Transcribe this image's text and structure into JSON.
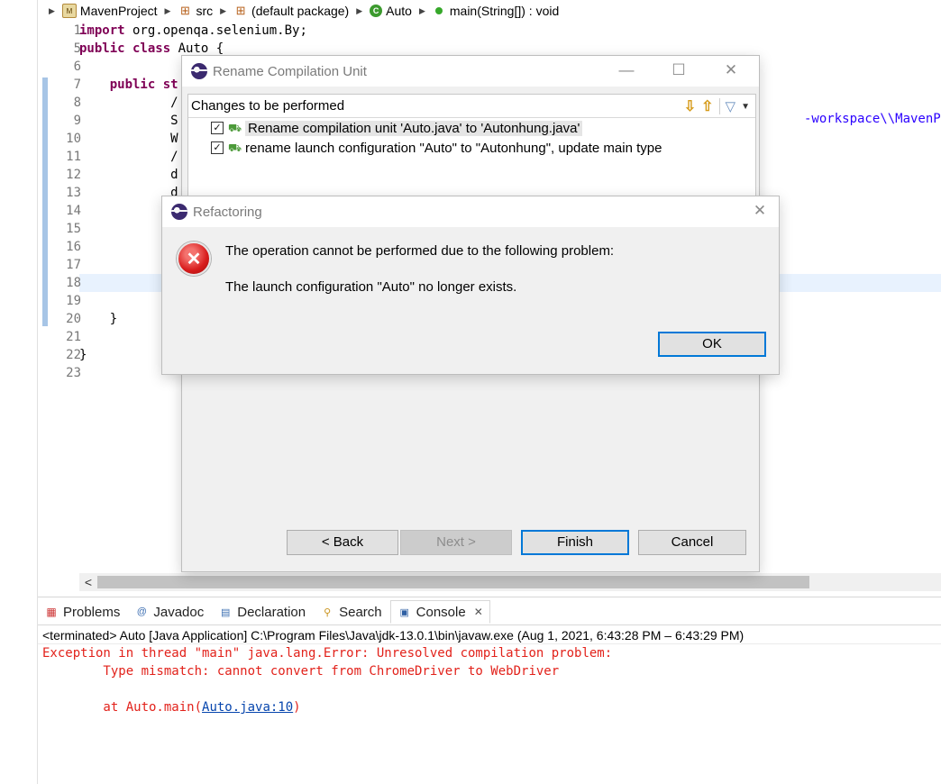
{
  "breadcrumb": {
    "project": "MavenProject",
    "src": "src",
    "package": "(default package)",
    "class": "Auto",
    "method": "main(String[]) : void"
  },
  "editor": {
    "line_numbers": [
      "1",
      "5",
      "6",
      "7",
      "8",
      "9",
      "10",
      "11",
      "12",
      "13",
      "14",
      "15",
      "16",
      "17",
      "18",
      "19",
      "20",
      "21",
      "22",
      "23"
    ],
    "lines": [
      {
        "kw": "import",
        "rest": " org.openqa.selenium.By;"
      },
      {
        "kw": "public class",
        "rest": " Auto {"
      },
      {
        "kw": "",
        "rest": ""
      },
      {
        "kw": "    public st",
        "rest": ""
      },
      {
        "kw": "",
        "rest": "            /"
      },
      {
        "kw": "",
        "rest": "            S"
      },
      {
        "kw": "",
        "rest": "            W"
      },
      {
        "kw": "",
        "rest": "            /"
      },
      {
        "kw": "",
        "rest": "            d"
      },
      {
        "kw": "",
        "rest": "            d"
      },
      {
        "kw": "",
        "rest": ""
      },
      {
        "kw": "",
        "rest": ""
      },
      {
        "kw": "",
        "rest": ""
      },
      {
        "kw": "",
        "rest": ""
      },
      {
        "kw": "",
        "rest": ""
      },
      {
        "kw": "",
        "rest": ""
      },
      {
        "kw": "",
        "rest": "    }"
      },
      {
        "kw": "",
        "rest": ""
      },
      {
        "kw": "",
        "rest": "}"
      },
      {
        "kw": "",
        "rest": ""
      }
    ],
    "string_fragment": "-workspace\\\\MavenProjec"
  },
  "rename_dialog": {
    "title": "Rename Compilation Unit",
    "changes_label": "Changes to be performed",
    "changes": [
      {
        "text": "Rename compilation unit 'Auto.java' to 'Autonhung.java'",
        "checked": true
      },
      {
        "text": "rename launch configuration \"Auto\" to \"Autonhung\", update main type",
        "checked": true
      }
    ],
    "back_label": "< Back",
    "next_label": "Next >",
    "finish_label": "Finish",
    "cancel_label": "Cancel"
  },
  "refactoring_dialog": {
    "title": "Refactoring",
    "message_1": "The operation cannot be performed due to the following problem:",
    "message_2": "The launch configuration \"Auto\" no longer exists.",
    "ok_label": "OK"
  },
  "views": {
    "tabs": [
      {
        "label": "Problems",
        "icon": "problems-icon"
      },
      {
        "label": "Javadoc",
        "icon": "javadoc-icon"
      },
      {
        "label": "Declaration",
        "icon": "declaration-icon"
      },
      {
        "label": "Search",
        "icon": "search-icon"
      },
      {
        "label": "Console",
        "icon": "console-icon",
        "active": true
      }
    ],
    "console_header": "<terminated> Auto [Java Application] C:\\Program Files\\Java\\jdk-13.0.1\\bin\\javaw.exe  (Aug 1, 2021, 6:43:28 PM – 6:43:29 PM)",
    "console_lines": [
      "Exception in thread \"main\" java.lang.Error: Unresolved compilation problem: ",
      "        Type mismatch: cannot convert from ChromeDriver to WebDriver",
      "",
      "        at Auto.main("
    ],
    "console_link": "Auto.java:10",
    "console_tail": ")"
  },
  "colors": {
    "keyword": "#7f0055",
    "console_error": "#e2221b",
    "string": "#2a00ff",
    "default_button_border": "#0078d7"
  }
}
